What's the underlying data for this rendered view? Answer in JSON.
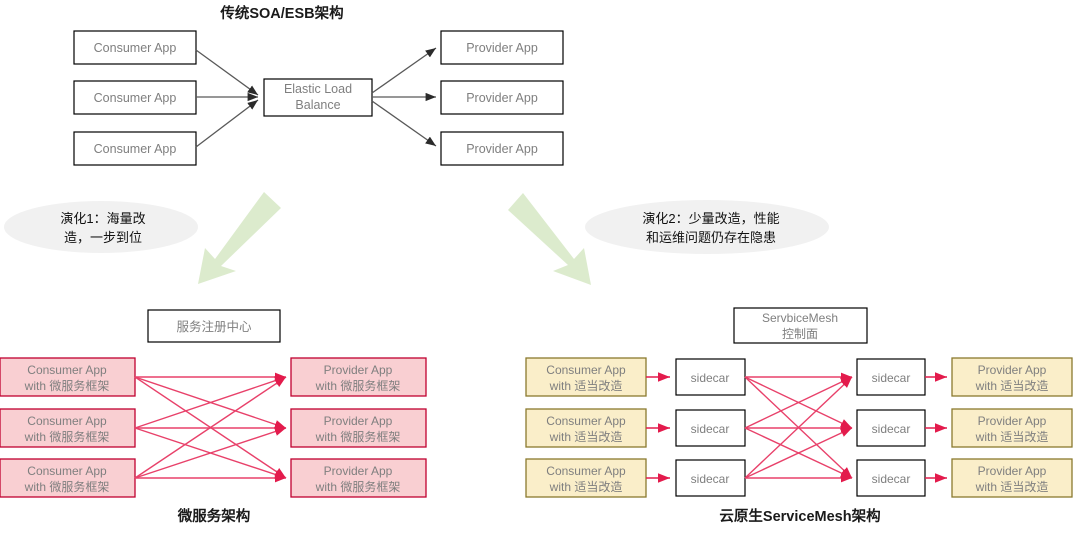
{
  "diagram": {
    "title_top": "传统SOA/ESB架构",
    "title_bottom_left": "微服务架构",
    "title_bottom_right": "云原生ServiceMesh架构",
    "colors": {
      "pink_fill": "#f9cfd2",
      "pink_stroke": "#c00030",
      "yellow_fill": "#faeec9",
      "yellow_stroke": "#8a7a2e",
      "green_arrow": "#dcebcd",
      "ellipse_fill": "#f1f1f1",
      "gray_text": "#7f7f7f",
      "red_link": "#e8416a",
      "gray_link": "#595959"
    }
  },
  "soa": {
    "consumers": [
      {
        "label": "Consumer App"
      },
      {
        "label": "Consumer App"
      },
      {
        "label": "Consumer App"
      }
    ],
    "load_balancer": {
      "line1": "Elastic Load",
      "line2": "Balance"
    },
    "providers": [
      {
        "label": "Provider App"
      },
      {
        "label": "Provider App"
      },
      {
        "label": "Provider App"
      }
    ]
  },
  "evolutions": [
    {
      "id": "evolution-1",
      "line1": "演化1：海量改",
      "line2": "造，一步到位"
    },
    {
      "id": "evolution-2",
      "line1": "演化2：少量改造，性能",
      "line2": "和运维问题仍存在隐患"
    }
  ],
  "microservice": {
    "registry": "服务注册中心",
    "consumers": [
      {
        "line1": "Consumer App",
        "line2": "with 微服务框架"
      },
      {
        "line1": "Consumer App",
        "line2": "with 微服务框架"
      },
      {
        "line1": "Consumer App",
        "line2": "with 微服务框架"
      }
    ],
    "providers": [
      {
        "line1": "Provider App",
        "line2": "with 微服务框架"
      },
      {
        "line1": "Provider App",
        "line2": "with 微服务框架"
      },
      {
        "line1": "Provider App",
        "line2": "with 微服务框架"
      }
    ]
  },
  "servicemesh": {
    "control_plane": {
      "line1": "ServbiceMesh",
      "line2": "控制面"
    },
    "consumers": [
      {
        "line1": "Consumer App",
        "line2": "with 适当改造"
      },
      {
        "line1": "Consumer App",
        "line2": "with 适当改造"
      },
      {
        "line1": "Consumer App",
        "line2": "with 适当改造"
      }
    ],
    "sidecars_left": [
      {
        "label": "sidecar"
      },
      {
        "label": "sidecar"
      },
      {
        "label": "sidecar"
      }
    ],
    "sidecars_right": [
      {
        "label": "sidecar"
      },
      {
        "label": "sidecar"
      },
      {
        "label": "sidecar"
      }
    ],
    "providers": [
      {
        "line1": "Provider App",
        "line2": "with 适当改造"
      },
      {
        "line1": "Provider App",
        "line2": "with 适当改造"
      },
      {
        "line1": "Provider App",
        "line2": "with 适当改造"
      }
    ]
  }
}
